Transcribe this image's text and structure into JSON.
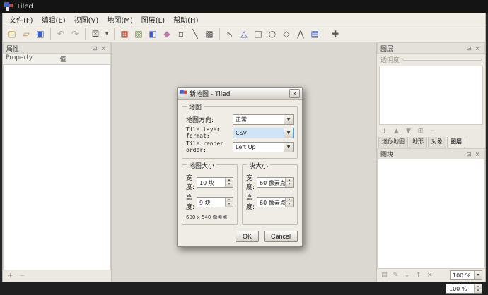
{
  "titlebar": {
    "title": "Tiled"
  },
  "menubar": {
    "items": [
      "文件(F)",
      "编辑(E)",
      "视图(V)",
      "地图(M)",
      "图层(L)",
      "帮助(H)"
    ]
  },
  "toolbar": {
    "icons": {
      "new_map": "▢",
      "open_map": "▱",
      "save_map": "▣",
      "undo": "↶",
      "redo": "↷",
      "random_mode": "⚄",
      "random_dropdown": "▾",
      "stamp_brush": "▦",
      "terrain_brush": "▨",
      "bucket_fill": "◧",
      "eraser": "◆",
      "rect_select": "▫",
      "magic_wand": "╲",
      "same_tile_select": "▩",
      "select_objects": "↖",
      "edit_polygons": "△",
      "insert_rectangle": "□",
      "insert_ellipse": "○",
      "insert_polygon": "◇",
      "insert_polyline": "⋀",
      "insert_tile": "▤",
      "move_tool": "✚"
    }
  },
  "dock_buttons": {
    "float_icon": "⊡",
    "close_icon": "×"
  },
  "properties_panel": {
    "title": "属性",
    "columns": [
      "Property",
      "值"
    ],
    "add_icon": "+",
    "remove_icon": "−"
  },
  "layers_panel": {
    "title": "图层",
    "opacity_label": "透明度",
    "buttons": {
      "new_layer": "+",
      "raise": "▲",
      "lower": "▼",
      "duplicate": "⊞",
      "remove": "−"
    },
    "tabs": [
      "迷你地图",
      "地形",
      "对象",
      "图层"
    ]
  },
  "tilesets_panel": {
    "title": "图块",
    "buttons": {
      "new_tileset": "▤",
      "properties": "✎",
      "import": "↓",
      "export": "↑",
      "remove": "×"
    },
    "zoom_value": "100 %",
    "zoom_arrow": "▾"
  },
  "statusbar": {
    "zoom_value": "100 %",
    "spin_up": "▴",
    "spin_down": "▾"
  },
  "dialog": {
    "title": "新地图 - Tiled",
    "close_icon": "×",
    "map_group": "地图",
    "orientation_label": "地图方向:",
    "orientation_value": "正常",
    "layer_format_label": "Tile layer format:",
    "layer_format_value": "CSV",
    "render_order_label": "Tile render order:",
    "render_order_value": "Left Up",
    "combo_arrow": "▼",
    "map_size_group": "地图大小",
    "tile_size_group": "块大小",
    "width_label": "宽度:",
    "height_label": "高度:",
    "map_width_value": "10 块",
    "map_height_value": "9 块",
    "pixel_summary": "600 x 540 像素点",
    "tile_width_value": "60 像素点",
    "tile_height_value": "60 像素点",
    "spin_up": "▴",
    "spin_down": "▾",
    "ok_label": "OK",
    "cancel_label": "Cancel"
  }
}
